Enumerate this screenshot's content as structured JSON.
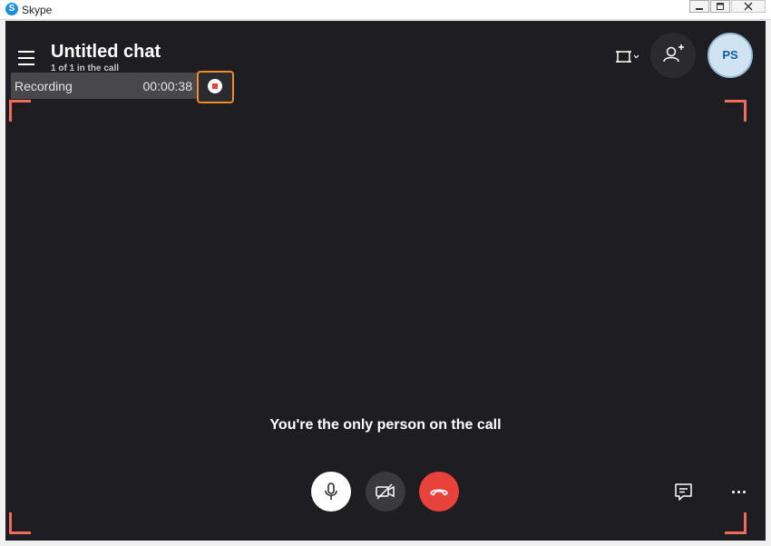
{
  "window": {
    "app_name": "Skype",
    "logo_letter": "S",
    "controls": [
      "minimize-icon",
      "maximize-icon",
      "close-icon"
    ]
  },
  "header": {
    "title": "Untitled chat",
    "subtitle": "1 of 1 in the call"
  },
  "recording": {
    "label": "Recording",
    "elapsed": "00:00:38"
  },
  "avatar": {
    "initials": "PS"
  },
  "call": {
    "message": "You're the only person on the call"
  },
  "icons": {
    "menu": "hamburger-menu-icon",
    "layout": "view-layout-icon",
    "add_person": "add-person-icon",
    "stop_recording": "stop-recording-icon",
    "mic": "microphone-icon",
    "camera_off": "camera-off-icon",
    "hang_up": "hang-up-icon",
    "chat": "chat-icon",
    "more": "more-options-icon"
  },
  "colors": {
    "call_background": "#1e1e22",
    "accent_corners": "#f26b5b",
    "stop_highlight": "#f08a2c",
    "hang_up": "#e8423a"
  }
}
